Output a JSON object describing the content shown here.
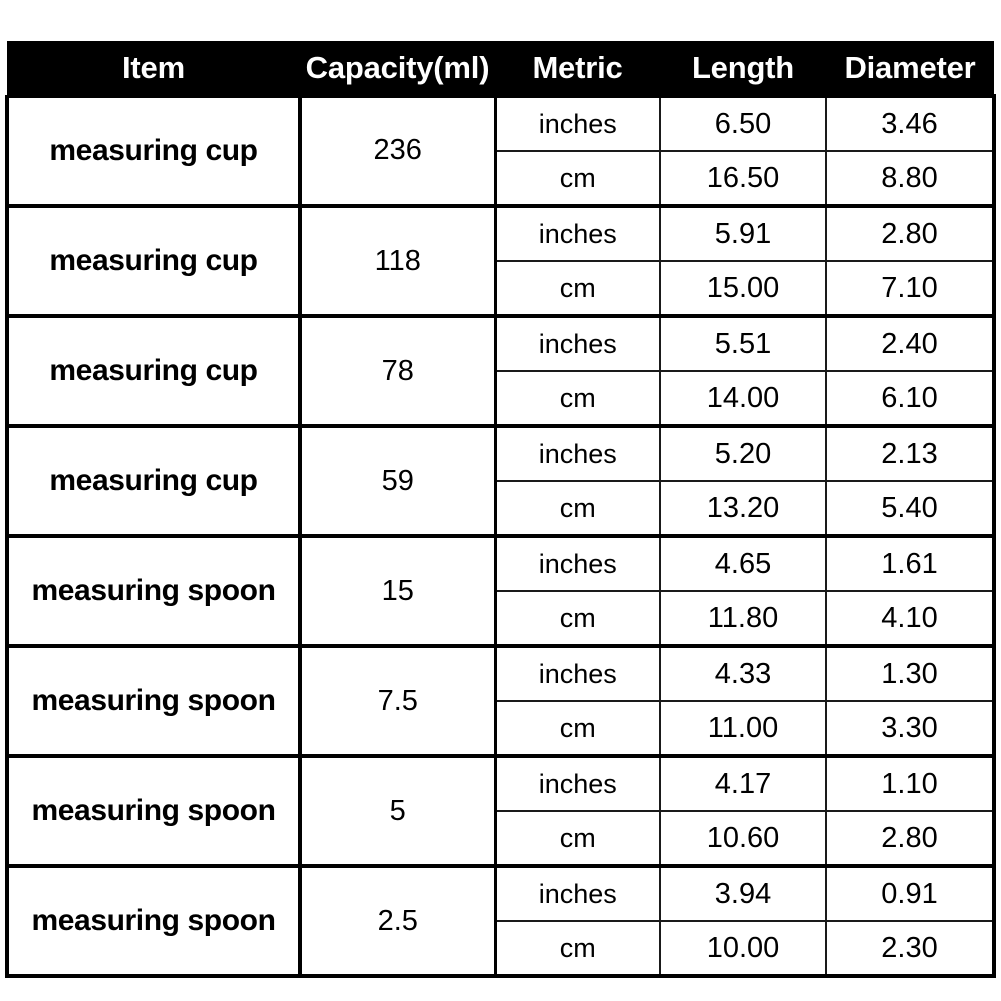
{
  "table": {
    "columns": [
      {
        "key": "item",
        "label": "Item"
      },
      {
        "key": "capacity",
        "label": "Capacity(ml)"
      },
      {
        "key": "metric",
        "label": "Metric"
      },
      {
        "key": "length",
        "label": "Length"
      },
      {
        "key": "diameter",
        "label": "Diameter"
      }
    ],
    "header_background": "#000000",
    "header_text_color": "#ffffff",
    "border_color": "#000000",
    "body_background": "#ffffff",
    "rows": [
      {
        "item": "measuring cup",
        "capacity": "236",
        "metrics": [
          {
            "metric": "inches",
            "length": "6.50",
            "diameter": "3.46"
          },
          {
            "metric": "cm",
            "length": "16.50",
            "diameter": "8.80"
          }
        ]
      },
      {
        "item": "measuring cup",
        "capacity": "118",
        "metrics": [
          {
            "metric": "inches",
            "length": "5.91",
            "diameter": "2.80"
          },
          {
            "metric": "cm",
            "length": "15.00",
            "diameter": "7.10"
          }
        ]
      },
      {
        "item": "measuring cup",
        "capacity": "78",
        "metrics": [
          {
            "metric": "inches",
            "length": "5.51",
            "diameter": "2.40"
          },
          {
            "metric": "cm",
            "length": "14.00",
            "diameter": "6.10"
          }
        ]
      },
      {
        "item": "measuring cup",
        "capacity": "59",
        "metrics": [
          {
            "metric": "inches",
            "length": "5.20",
            "diameter": "2.13"
          },
          {
            "metric": "cm",
            "length": "13.20",
            "diameter": "5.40"
          }
        ]
      },
      {
        "item": "measuring spoon",
        "capacity": "15",
        "metrics": [
          {
            "metric": "inches",
            "length": "4.65",
            "diameter": "1.61"
          },
          {
            "metric": "cm",
            "length": "11.80",
            "diameter": "4.10"
          }
        ]
      },
      {
        "item": "measuring spoon",
        "capacity": "7.5",
        "metrics": [
          {
            "metric": "inches",
            "length": "4.33",
            "diameter": "1.30"
          },
          {
            "metric": "cm",
            "length": "11.00",
            "diameter": "3.30"
          }
        ]
      },
      {
        "item": "measuring spoon",
        "capacity": "5",
        "metrics": [
          {
            "metric": "inches",
            "length": "4.17",
            "diameter": "1.10"
          },
          {
            "metric": "cm",
            "length": "10.60",
            "diameter": "2.80"
          }
        ]
      },
      {
        "item": "measuring spoon",
        "capacity": "2.5",
        "metrics": [
          {
            "metric": "inches",
            "length": "3.94",
            "diameter": "0.91"
          },
          {
            "metric": "cm",
            "length": "10.00",
            "diameter": "2.30"
          }
        ]
      }
    ]
  }
}
